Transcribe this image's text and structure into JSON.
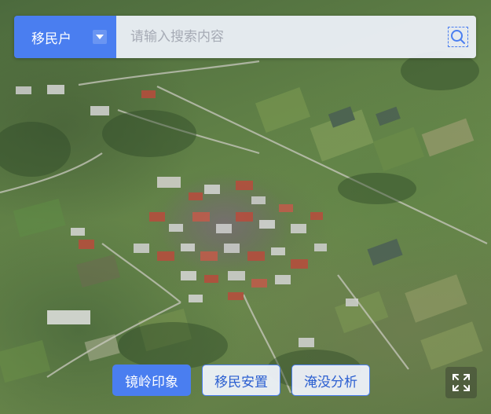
{
  "search": {
    "category_label": "移民户",
    "placeholder": "请输入搜索内容"
  },
  "icons": {
    "dropdown": "chevron-down-icon",
    "search": "search-icon",
    "fullscreen": "fullscreen-icon"
  },
  "buttons": [
    {
      "label": "镜岭印象",
      "active": true
    },
    {
      "label": "移民安置",
      "active": false
    },
    {
      "label": "淹没分析",
      "active": false
    }
  ],
  "colors": {
    "accent": "#4a7ef0",
    "bar_background": "#eef2fa"
  }
}
